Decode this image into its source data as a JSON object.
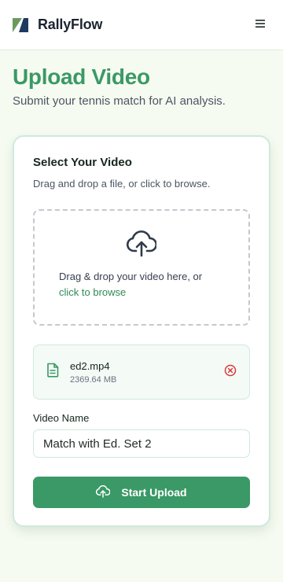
{
  "header": {
    "brand": "RallyFlow",
    "logo_icon": "rallyflow-logo-icon",
    "menu_icon": "hamburger-menu-icon"
  },
  "hero": {
    "title": "Upload Video",
    "subtitle": "Submit your tennis match for AI analysis."
  },
  "card": {
    "title": "Select Your Video",
    "description": "Drag and drop a file, or click to browse.",
    "dropzone": {
      "icon": "cloud-upload-icon",
      "text": "Drag & drop your video here, or",
      "link": "click to browse"
    },
    "file": {
      "icon": "file-text-icon",
      "name": "ed2.mp4",
      "size": "2369.64 MB",
      "remove_icon": "remove-circle-x-icon"
    },
    "video_name": {
      "label": "Video Name",
      "value": "Match with Ed. Set 2"
    },
    "submit": {
      "icon": "cloud-upload-icon",
      "label": "Start Upload"
    }
  },
  "colors": {
    "accent": "#3a9966",
    "link": "#2f8a55",
    "remove": "#d63a3a",
    "logo_dark": "#1e3a5f",
    "logo_green": "#5a8a4e"
  }
}
